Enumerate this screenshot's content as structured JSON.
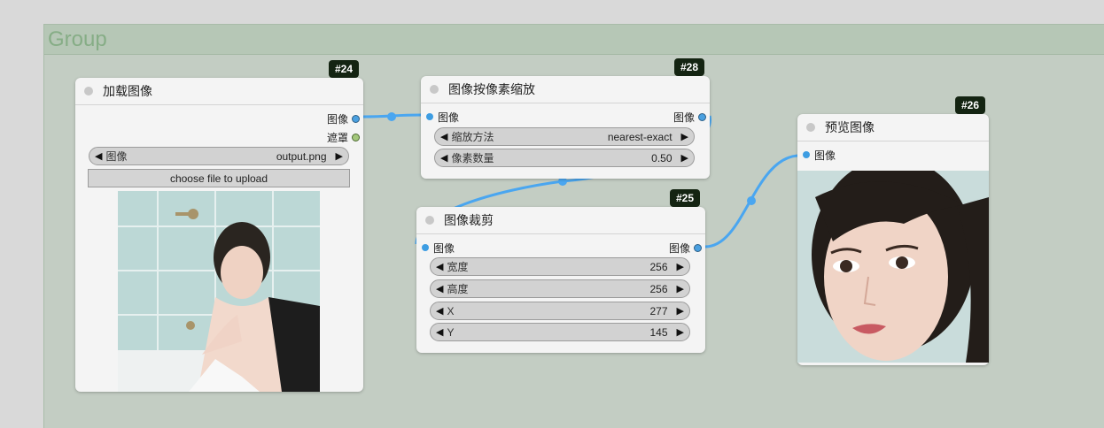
{
  "group": {
    "title": "Group"
  },
  "nodes": {
    "load": {
      "id": "#24",
      "title": "加载图像",
      "outputs": [
        "图像",
        "遮罩"
      ],
      "widget": {
        "label": "图像",
        "value": "output.png"
      },
      "upload_label": "choose file to upload"
    },
    "scale": {
      "id": "#28",
      "title": "图像按像素缩放",
      "input": "图像",
      "output": "图像",
      "widgets": [
        {
          "label": "缩放方法",
          "value": "nearest-exact"
        },
        {
          "label": "像素数量",
          "value": "0.50"
        }
      ]
    },
    "crop": {
      "id": "#25",
      "title": "图像裁剪",
      "input": "图像",
      "output": "图像",
      "widgets": [
        {
          "label": "宽度",
          "value": "256"
        },
        {
          "label": "高度",
          "value": "256"
        },
        {
          "label": "X",
          "value": "277"
        },
        {
          "label": "Y",
          "value": "145"
        }
      ]
    },
    "preview": {
      "id": "#26",
      "title": "预览图像",
      "input": "图像"
    }
  },
  "colors": {
    "link": "#4aa6f0",
    "group_bg": "#c3cdc3",
    "badge_bg": "#142412"
  },
  "icons": {
    "decrement": "left-arrow-icon",
    "increment": "right-arrow-icon"
  }
}
